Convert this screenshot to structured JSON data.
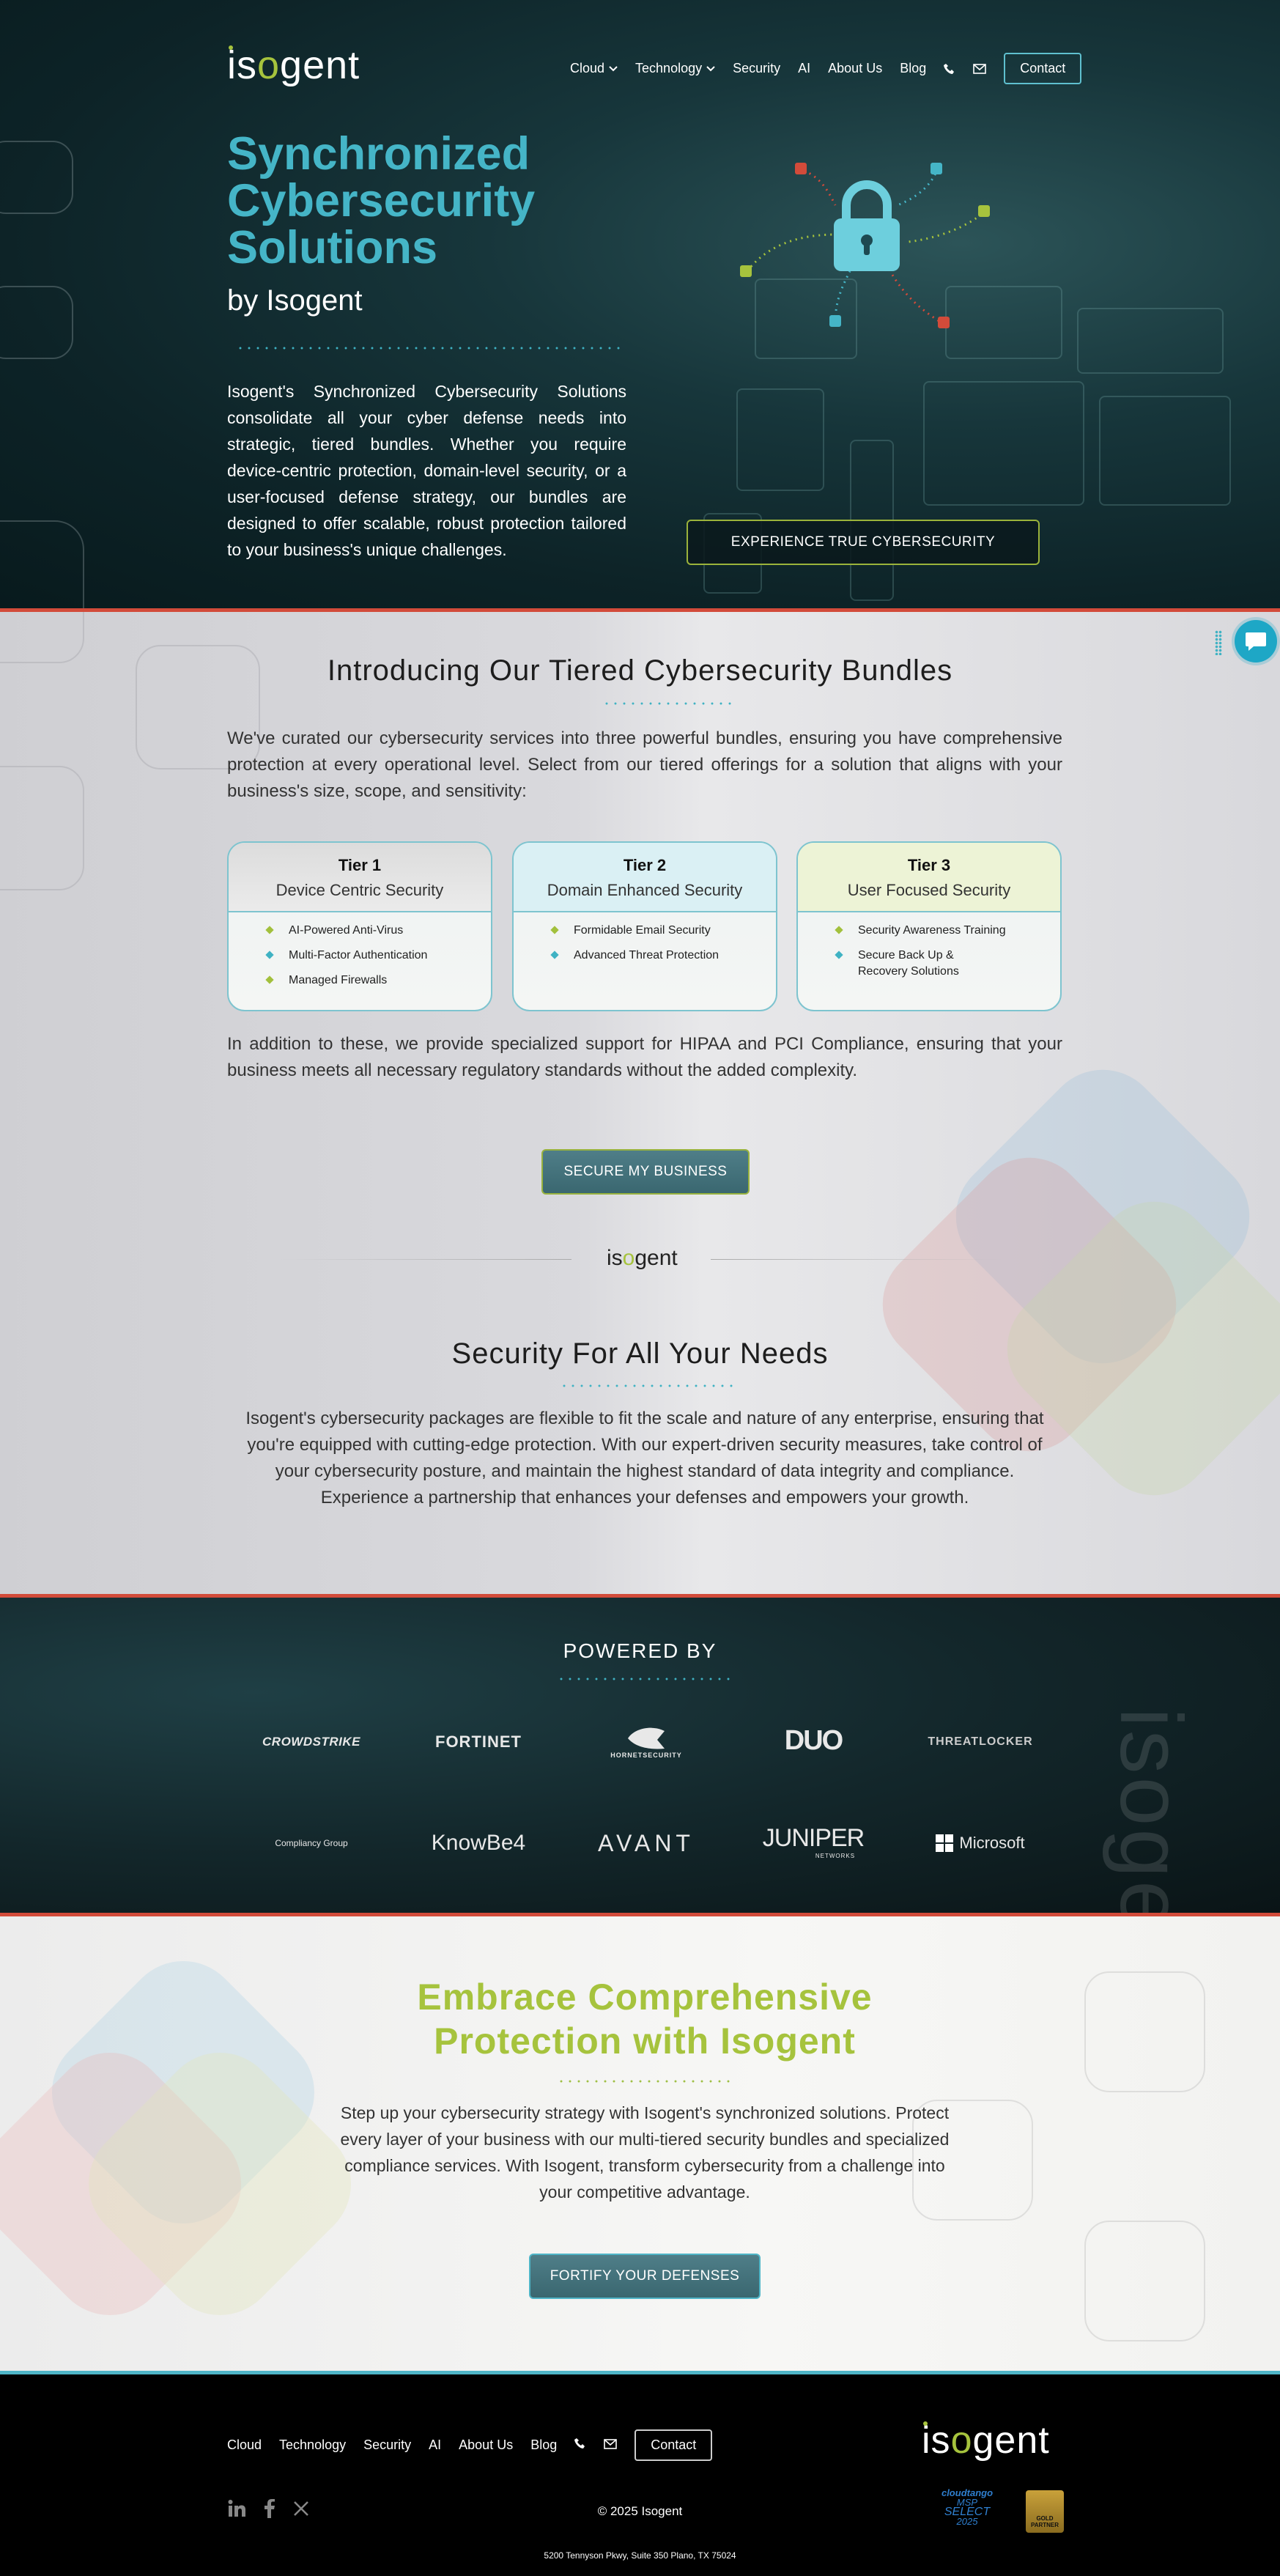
{
  "brand": {
    "name_part1": "is",
    "name_o": "o",
    "name_part2": "gent"
  },
  "nav": {
    "items": [
      "Cloud",
      "Technology",
      "Security",
      "AI",
      "About Us",
      "Blog"
    ],
    "contact": "Contact"
  },
  "hero": {
    "title": "Synchronized Cybersecurity Solutions",
    "subtitle": "by Isogent",
    "paragraph": "Isogent's Synchronized Cybersecurity Solutions consolidate all your cyber defense needs into strategic, tiered bundles. Whether you require device-centric protection, domain-level security, or a user-focused defense strategy, our bundles are designed to offer scalable, robust protection tailored to your business's unique challenges.",
    "cta": "EXPERIENCE TRUE CYBERSECURITY"
  },
  "intro": {
    "title": "Introducing Our Tiered Cybersecurity Bundles",
    "paragraph": "We've curated our cybersecurity services into three powerful bundles, ensuring you have comprehensive protection at every operational level. Select from our tiered offerings for a solution that aligns with your business's size, scope, and sensitivity:",
    "tiers": [
      {
        "label": "Tier 1",
        "name": "Device Centric Security",
        "items": [
          "AI-Powered Anti-Virus",
          "Multi-Factor Authentication",
          "Managed Firewalls"
        ]
      },
      {
        "label": "Tier 2",
        "name": "Domain Enhanced Security",
        "items": [
          "Formidable Email Security",
          "Advanced Threat Protection"
        ]
      },
      {
        "label": "Tier 3",
        "name": "User Focused Security",
        "items": [
          "Security Awareness Training",
          "Secure Back Up & Recovery Solutions"
        ]
      }
    ],
    "compliance": "In addition to these, we provide specialized support for HIPAA and PCI Compliance, ensuring that your business meets all necessary regulatory standards without the added complexity.",
    "cta": "SECURE MY BUSINESS"
  },
  "needs": {
    "title": "Security For All Your Needs",
    "paragraph": "Isogent's cybersecurity packages are flexible to fit the scale and nature of any enterprise, ensuring that you're equipped with cutting-edge protection. With our expert-driven security measures, take control of your cybersecurity posture, and maintain the highest standard of data integrity and compliance. Experience a partnership that enhances your defenses and empowers your growth."
  },
  "powered": {
    "title": "POWERED BY",
    "logos": [
      "CROWDSTRIKE",
      "FORTINET",
      "HORNETSECURITY",
      "DUO",
      "THREATLOCKER",
      "Compliancy Group",
      "KnowBe4",
      "AVANT",
      "JUNIPER",
      "NETWORKS",
      "Microsoft"
    ],
    "watermark": "isogent"
  },
  "embrace": {
    "title": "Embrace Comprehensive Protection with Isogent",
    "paragraph": "Step up your cybersecurity strategy with Isogent's synchronized solutions. Protect every layer of your business with our multi-tiered security bundles and specialized compliance services. With Isogent, transform cybersecurity from a challenge into your competitive advantage.",
    "cta": "FORTIFY YOUR DEFENSES"
  },
  "footer": {
    "copyright": "© 2025 Isogent",
    "address": "5200 Tennyson Pkwy, Suite 350 Plano, TX 75024",
    "badge1": [
      "cloudtango",
      "MSP",
      "SELECT",
      "2025"
    ],
    "badge2": [
      "GOLD",
      "PARTNER"
    ]
  },
  "colors": {
    "teal": "#45b5c7",
    "lime": "#a6c33d",
    "red": "#d24b3a",
    "dark": "#0d2327"
  },
  "icons": [
    "chevron-down-icon",
    "phone-icon",
    "mail-icon",
    "lock-icon",
    "chat-icon",
    "linkedin-icon",
    "facebook-icon",
    "x-icon"
  ]
}
